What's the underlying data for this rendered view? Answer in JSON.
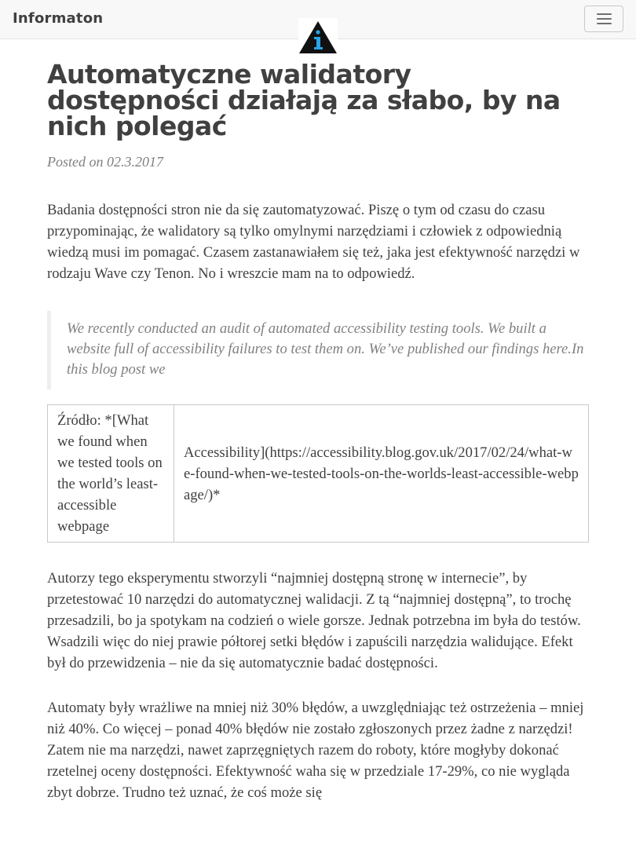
{
  "navbar": {
    "brand": "Informaton",
    "logo_icon": "info-logo-icon",
    "toggle_icon": "hamburger-menu-icon"
  },
  "post": {
    "title": "Automatyczne walidatory dostępności działają za słabo, by na nich polegać",
    "meta": "Posted on 02.3.2017",
    "paragraph1": "Badania dostępności stron nie da się zautomatyzować. Piszę o tym od czasu do czasu przypominając, że walidatory są tylko omylnymi narzędziami i człowiek z odpowiednią wiedzą musi im pomagać. Czasem zastanawiałem się też, jaka jest efektywność narzędzi w rodzaju Wave czy Tenon. No i wreszcie mam na to odpowiedź.",
    "quote": "We recently conducted an audit of automated accessibility testing tools. We built a website full of accessibility failures to test them on. We’ve published our findings here.In this blog post we",
    "source_table": {
      "cell1": "Źródło: *[What we found when we tested tools on the world’s least-accessible webpage",
      "cell2": "Accessibility](https://accessibility.blog.gov.uk/2017/02/24/what-we-found-when-we-tested-tools-on-the-worlds-least-accessible-webpage/)*"
    },
    "paragraph2": "Autorzy tego eksperymentu stworzyli “najmniej dostępną stronę w internecie”, by przetestować 10 narzędzi do automatycznej walidacji. Z tą “najmniej dostępną”, to trochę przesadzili, bo ja spotykam na codzień o wiele gorsze. Jednak potrzebna im była do testów. Wsadzili więc do niej prawie półtorej setki błędów i zapuścili narzędzia walidujące. Efekt był do przewidzenia – nie da się automatycznie badać dostępności.",
    "paragraph3": "Automaty były wrażliwe na mniej niż 30% błędów, a uwzględniając też ostrzeżenia – mniej niż 40%. Co więcej – ponad 40% błędów nie zostało zgłoszonych przez żadne z narzędzi! Zatem nie ma narzędzi, nawet zaprzęgniętych razem do roboty, które mogłyby dokonać rzetelnej oceny dostępności. Efektywność waha się w przedziale 17-29%, co nie wygląda zbyt dobrze. Trudno też uznać, że coś może się"
  }
}
